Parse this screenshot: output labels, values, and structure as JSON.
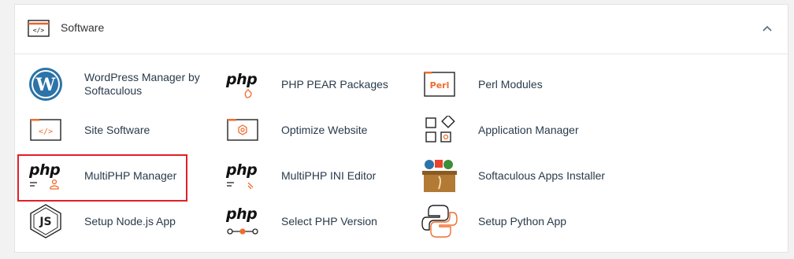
{
  "section": {
    "title": "Software",
    "collapse_icon": "chevron-up-icon"
  },
  "items": [
    {
      "label": "WordPress Manager by Softaculous",
      "icon": "wordpress-icon"
    },
    {
      "label": "PHP PEAR Packages",
      "icon": "php-pear-icon",
      "icon_text": "php"
    },
    {
      "label": "Perl Modules",
      "icon": "perl-icon",
      "icon_text": "Perl"
    },
    {
      "label": "Site Software",
      "icon": "code-window-icon"
    },
    {
      "label": "Optimize Website",
      "icon": "optimize-gear-icon"
    },
    {
      "label": "Application Manager",
      "icon": "application-grid-icon"
    },
    {
      "label": "MultiPHP Manager",
      "icon": "php-user-icon",
      "icon_text": "php"
    },
    {
      "label": "MultiPHP INI Editor",
      "icon": "php-ini-icon",
      "icon_text": "php"
    },
    {
      "label": "Softaculous Apps Installer",
      "icon": "softaculous-box-icon"
    },
    {
      "label": "Setup Node.js App",
      "icon": "nodejs-icon"
    },
    {
      "label": "Select PHP Version",
      "icon": "php-version-icon",
      "icon_text": "php"
    },
    {
      "label": "Setup Python App",
      "icon": "python-icon"
    }
  ],
  "highlighted_item": "MultiPHP Manager",
  "colors": {
    "accent": "#f26b2d",
    "highlight": "#e21f26",
    "text": "#293a4a"
  }
}
